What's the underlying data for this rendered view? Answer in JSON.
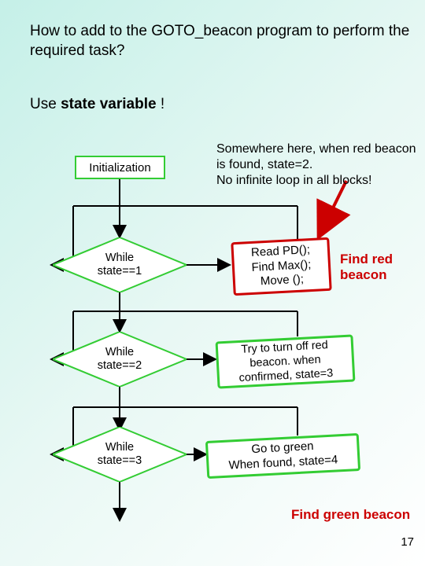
{
  "title": "How to add to the GOTO_beacon program to perform the required task?",
  "subtitle_pre": "Use ",
  "subtitle_bold": "state variable",
  "subtitle_post": " !",
  "annotation": "Somewhere here, when red beacon is found, state=2.\nNo infinite loop in all blocks!",
  "init": "Initialization",
  "diamonds": {
    "d1": "While\nstate==1",
    "d2": "While\nstate==2",
    "d3": "While\nstate==3"
  },
  "procs": {
    "p1": "Read PD();\nFind Max();\nMove ();",
    "p2": "Try to turn off red\nbeacon. when\nconfirmed, state=3",
    "p3": "Go to green\nWhen found, state=4"
  },
  "labels": {
    "red": "Find red\nbeacon",
    "green": "Find green\nbeacon"
  },
  "page": "17"
}
